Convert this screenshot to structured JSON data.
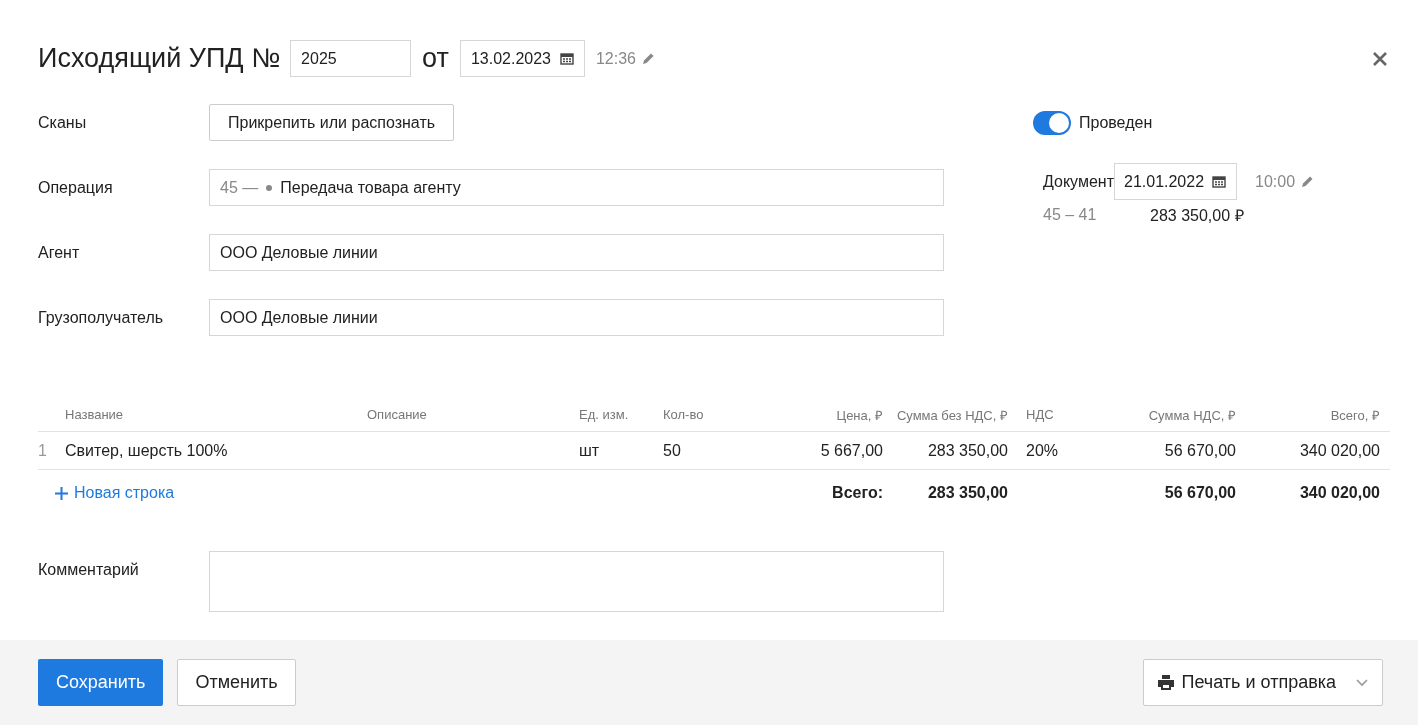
{
  "header": {
    "title": "Исходящий УПД №",
    "number": "2025",
    "from_label": "от",
    "date": "13.02.2023",
    "time": "12:36"
  },
  "form": {
    "fields": [
      {
        "kind": "button",
        "label": "Сканы",
        "value": "Прикрепить или распознать"
      },
      {
        "kind": "operation",
        "label": "Операция",
        "code": "45 —",
        "value": "Передача товара агенту"
      },
      {
        "kind": "input",
        "label": "Агент",
        "value": "ООО Деловые линии"
      },
      {
        "kind": "input",
        "label": "Грузополучатель",
        "value": "ООО Деловые линии"
      }
    ]
  },
  "posting": {
    "label": "Проведен",
    "on": true,
    "doc_label": "Документ",
    "doc_date": "21.01.2022",
    "doc_time": "10:00",
    "accounts": "45 – 41",
    "amount": "283 350,00 ₽"
  },
  "table": {
    "columns": [
      "Название",
      "Описание",
      "Ед. изм.",
      "Кол-во",
      "Цена, ₽",
      "Сумма без НДС, ₽",
      "НДС",
      "Сумма НДС, ₽",
      "Всего, ₽"
    ],
    "rows": [
      {
        "number": "1",
        "name": "Свитер, шерсть 100%",
        "unit": "шт",
        "qty": "50",
        "price": "5 667,00",
        "sum_without_vat": "283 350,00",
        "vat": "20%",
        "vat_sum": "56 670,00",
        "total": "340 020,00"
      }
    ],
    "add_row": "Новая строка",
    "totals": {
      "label": "Всего:",
      "sum_without_vat": "283 350,00",
      "vat_sum": "56 670,00",
      "total": "340 020,00"
    }
  },
  "comment": {
    "label": "Комментарий"
  },
  "footer": {
    "save": "Сохранить",
    "cancel": "Отменить",
    "print": "Печать и отправка"
  }
}
